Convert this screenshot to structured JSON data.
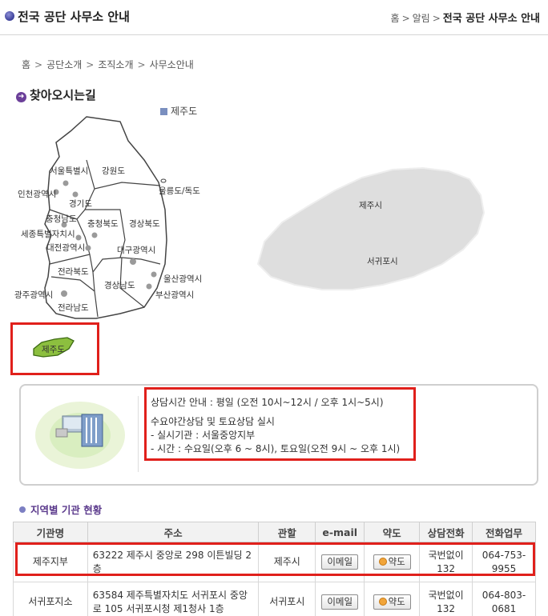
{
  "header": {
    "title": "전국 공단 사무소 안내",
    "crumbs": [
      "홈",
      "알림",
      "전국 공단 사무소 안내"
    ]
  },
  "breadcrumb": [
    "홈",
    "공단소개",
    "조직소개",
    "사무소안내"
  ],
  "section_title": "찾아오시는길",
  "jeju_link": "제주도",
  "map": {
    "regions": [
      "서울특별시",
      "강원도",
      "인천광역시",
      "경기도",
      "울릉도/독도",
      "충청남도",
      "충청북도",
      "경상북도",
      "세종특별자치시",
      "대전광역시",
      "대구광역시",
      "전라북도",
      "울산광역시",
      "경상남도",
      "광주광역시",
      "부산광역시",
      "전라남도",
      "제주도"
    ],
    "jeju_cities": [
      "제주시",
      "서귀포시"
    ]
  },
  "info": {
    "hours": "상담시간 안내 : 평일 (오전 10시~12시 / 오후 1시~5시)",
    "night": "수요야간상담 및 토요상담 실시",
    "place": "- 실시기관 : 서울중앙지부",
    "time": "- 시간 : 수요일(오후 6 ~ 8시), 토요일(오전 9시 ~ 오후 1시)"
  },
  "subsection_title": "지역별 기관 현황",
  "table": {
    "headers": [
      "기관명",
      "주소",
      "관할",
      "e-mail",
      "약도",
      "상담전화",
      "전화업무"
    ],
    "rows": [
      {
        "name": "제주지부",
        "addr1": "63222 제주시 중앙로 298 이튼빌딩 2",
        "addr2": "층",
        "area": "제주시",
        "email": "이메일",
        "map": "약도",
        "tel1": "국번없이",
        "tel2": "132",
        "phone": "064-753-9955"
      },
      {
        "name": "서귀포지소",
        "addr1": "63584 제주특별자치도 서귀포시 중앙",
        "addr2": "로 105 서귀포시청 제1청사 1층",
        "area": "서귀포시",
        "email": "이메일",
        "map": "약도",
        "tel1": "국번없이",
        "tel2": "132",
        "phone": "064-803-0681"
      }
    ]
  },
  "colors": {
    "highlight": "#e0201b",
    "jeju_fill": "#8cbf3f",
    "accent": "#5b3a8c"
  }
}
